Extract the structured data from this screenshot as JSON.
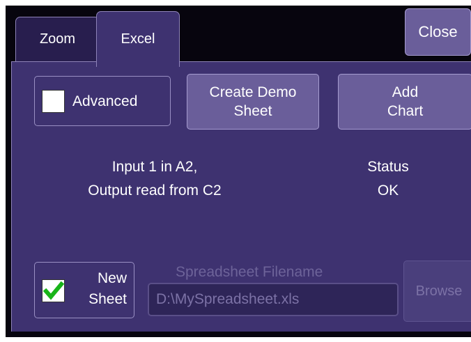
{
  "tabs": [
    {
      "label": "Zoom",
      "active": false
    },
    {
      "label": "Excel",
      "active": true
    }
  ],
  "close_label": "Close",
  "advanced": {
    "label": "Advanced",
    "checked": false
  },
  "create_demo": {
    "line1": "Create Demo",
    "line2": "Sheet"
  },
  "add_chart": {
    "line1": "Add",
    "line2": "Chart"
  },
  "io_info": {
    "line1": "Input 1 in A2,",
    "line2": "Output read from C2"
  },
  "status": {
    "label": "Status",
    "value": "OK"
  },
  "new_sheet": {
    "line1": "New",
    "line2": "Sheet",
    "checked": true
  },
  "spreadsheet": {
    "label": "Spreadsheet Filename",
    "value": "D:\\MySpreadsheet.xls"
  },
  "browse_label": "Browse",
  "colors": {
    "panel": "#3e3270",
    "button": "#6a5e9a",
    "check": "#18b418"
  }
}
